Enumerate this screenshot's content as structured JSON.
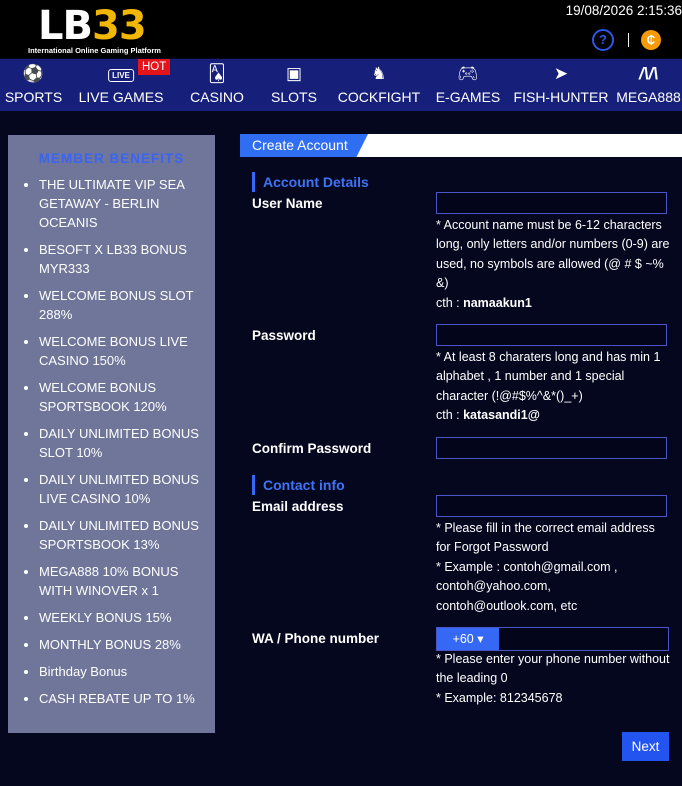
{
  "header": {
    "logo_name": "LB",
    "logo_num": "33",
    "logo_tagline": "International Online Gaming Platform",
    "datetime": "19/08/2026 2:15:36",
    "help_icon": "question-circle-icon",
    "coin_icon": "coin-icon"
  },
  "nav": {
    "items": [
      {
        "label": "SPORTS",
        "icon": "soccer-ball-icon"
      },
      {
        "label": "LIVE GAMES",
        "icon": "live-tv-icon"
      },
      {
        "label": "CASINO",
        "icon": "cards-icon"
      },
      {
        "label": "SLOTS",
        "icon": "slot-machine-icon"
      },
      {
        "label": "COCKFIGHT",
        "icon": "rooster-icon"
      },
      {
        "label": "E-GAMES",
        "icon": "gamepad-icon"
      },
      {
        "label": "FISH-HUNTER",
        "icon": "fish-icon"
      },
      {
        "label": "MEGA888",
        "icon": "mega-logo-icon"
      }
    ],
    "hot_badge": "HOT",
    "live_icon_text": "LIVE"
  },
  "sidebar": {
    "title": "MEMBER BENEFITS",
    "benefits": [
      "THE ULTIMATE VIP SEA GETAWAY - BERLIN OCEANIS",
      "BESOFT X LB33 BONUS MYR333",
      "WELCOME BONUS SLOT 288%",
      "WELCOME BONUS LIVE CASINO 150%",
      "WELCOME BONUS SPORTSBOOK 120%",
      "DAILY UNLIMITED BONUS SLOT 10%",
      "DAILY UNLIMITED BONUS LIVE CASINO 10%",
      "DAILY UNLIMITED BONUS SPORTSBOOK 13%",
      "MEGA888 10% BONUS WITH WINOVER x 1",
      "WEEKLY BONUS 15%",
      "MONTHLY BONUS 28%",
      "Birthday Bonus",
      "CASH REBATE UP TO 1%"
    ]
  },
  "form": {
    "tab_label": "Create Account",
    "account_section": "Account Details",
    "username_label": "User Name",
    "username_value": "",
    "username_hint": "* Account name must be 6-12 characters long, only letters and/or numbers (0-9) are used, no symbols are allowed (@ # $ ~% &)",
    "username_example_prefix": "cth : ",
    "username_example": "namaakun1",
    "password_label": "Password",
    "password_value": "",
    "password_hint": "* At least 8 charaters long and has min 1 alphabet , 1 number and 1 special character (!@#$%^&*()_+)",
    "password_example_prefix": "cth : ",
    "password_example": "katasandi1@",
    "confirm_label": "Confirm Password",
    "confirm_value": "",
    "contact_section": "Contact info",
    "email_label": "Email address",
    "email_value": "",
    "email_hint_1": "* Please fill in the correct email address for Forgot Password",
    "email_hint_2": "* Example : contoh@gmail.com ,",
    "email_hint_3": "contoh@yahoo.com,",
    "email_hint_4": "contoh@outlook.com, etc",
    "phone_label": "WA / Phone number",
    "phone_code": "+60 ▾",
    "phone_value": "",
    "phone_hint_1": "* Please enter your phone number without the leading 0",
    "phone_hint_2": "* Example: 812345678",
    "next_label": "Next"
  }
}
